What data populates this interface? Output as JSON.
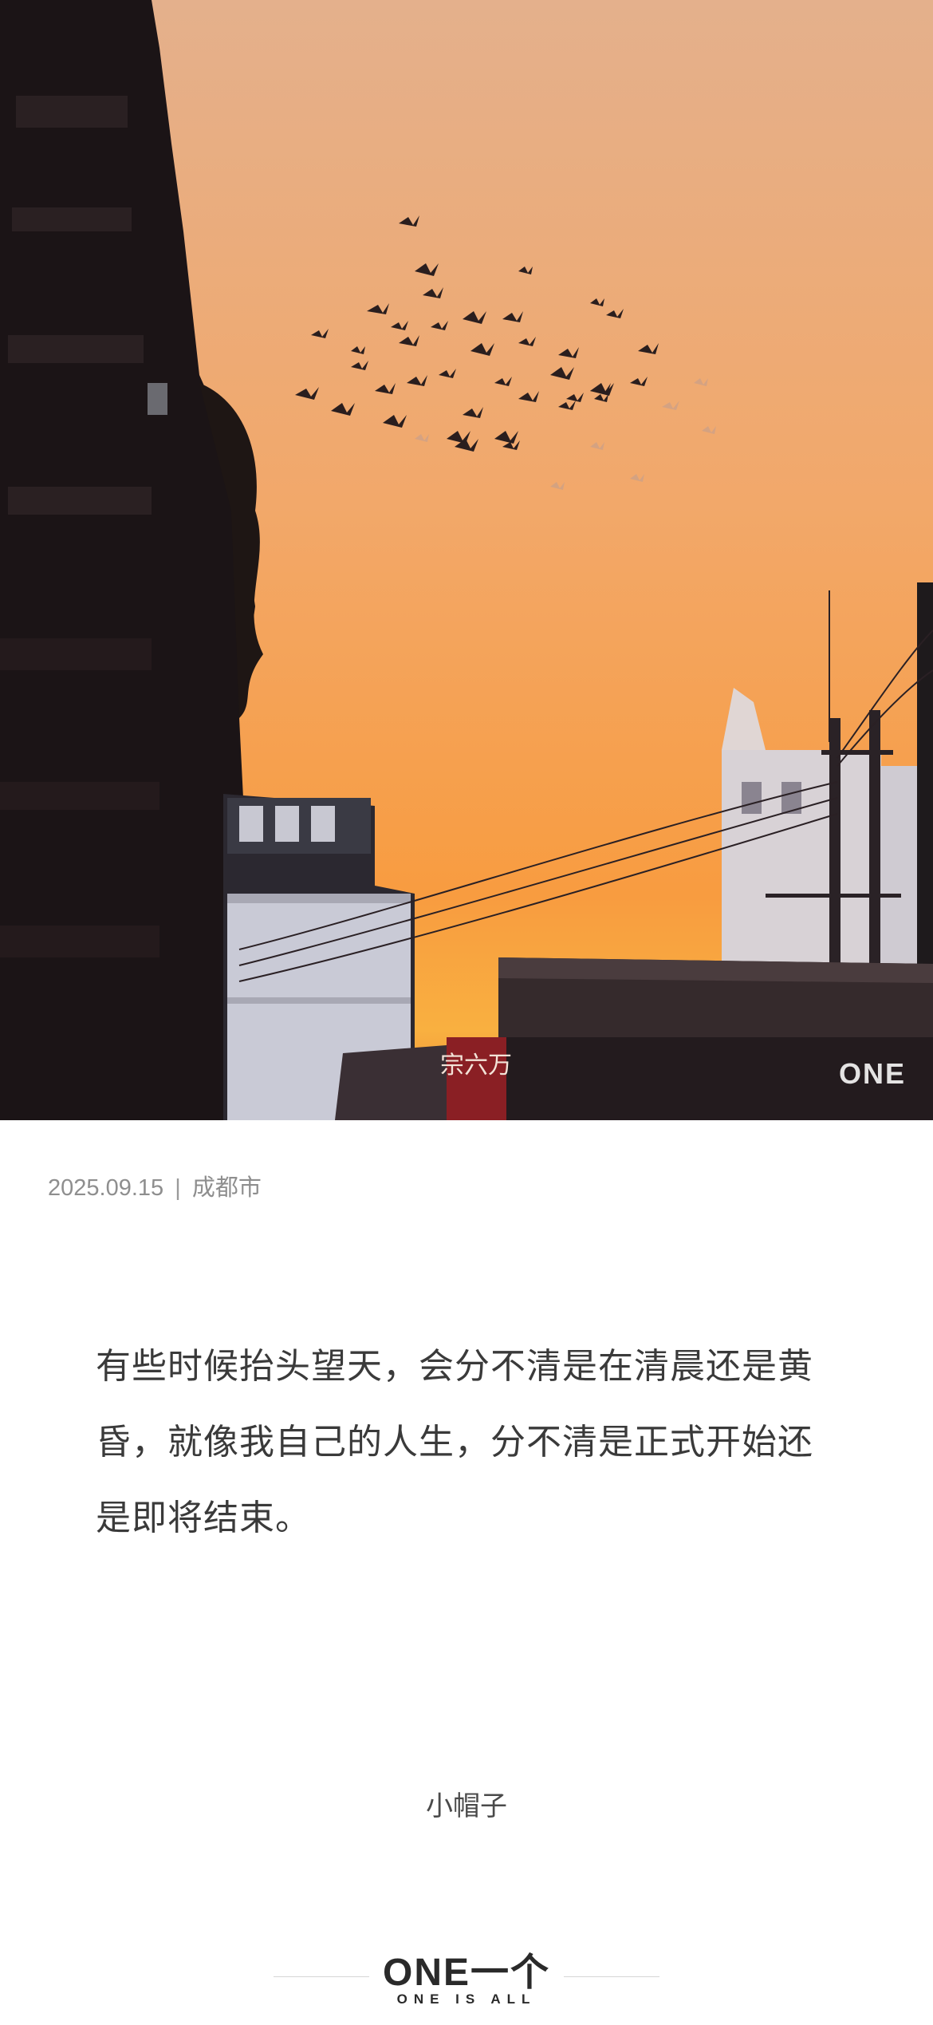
{
  "photo": {
    "subject": "sunset sky with flock of birds between buildings",
    "watermark": "ONE",
    "sign_text": "宗六万"
  },
  "meta": {
    "date": "2025.09.15",
    "separator": "|",
    "location": "成都市"
  },
  "quote": {
    "text": "有些时候抬头望天，会分不清是在清晨还是黄昏，就像我自己的人生，分不清是正式开始还是即将结束。"
  },
  "author": {
    "name": "小帽子"
  },
  "footer": {
    "logo": "ONE一个",
    "tagline": "ONE IS ALL"
  },
  "colors": {
    "sky_top": "#e8b48c",
    "sky_mid": "#f3a866",
    "sky_horizon": "#f79a3c",
    "text_main": "#3a3a3a",
    "text_meta": "#8e8e8e"
  }
}
